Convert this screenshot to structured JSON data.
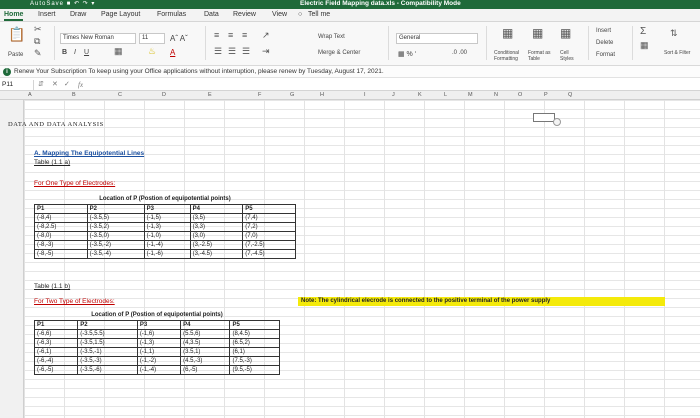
{
  "titlebar": {
    "quick_access": "AutoSave   ■ ↶ ↷ ▾",
    "title": "Electric Field Mapping data.xls  -  Compatibility Mode"
  },
  "tabs": [
    "Home",
    "Insert",
    "Draw",
    "Page Layout",
    "Formulas",
    "Data",
    "Review",
    "View"
  ],
  "tell_me": "Tell me",
  "ribbon": {
    "paste_label": "Paste",
    "font_name": "Times New Roman",
    "font_size": "11",
    "wrap_text": "Wrap Text",
    "merge_center": "Merge & Center",
    "number_format": "General",
    "conditional_formatting": "Conditional Formatting",
    "format_as_table": "Format as Table",
    "cell_styles": "Cell Styles",
    "insert": "Insert",
    "delete": "Delete",
    "format": "Format",
    "sort_filter": "Sort & Filter"
  },
  "notice": {
    "message": "Renew Your Subscription  To keep using your Office applications without interruption, please renew by Tuesday, August 17, 2021."
  },
  "formula_bar": {
    "cell_ref": "P11",
    "fx": "fx"
  },
  "columns": [
    "A",
    "B",
    "C",
    "D",
    "E",
    "F",
    "G",
    "H",
    "I",
    "J",
    "K",
    "L",
    "M",
    "N",
    "O",
    "P",
    "Q"
  ],
  "sheet": {
    "main_heading": "DATA AND DATA ANALYSIS",
    "section_title": "A. Mapping  The Equipotential Lines",
    "table1_label": "Table (1.1 a)",
    "table1_subtitle": "For One Type of Electrodes:",
    "table1_location_header": "Location of P (Postion of equipotential points)",
    "table1_headers": [
      "P1",
      "P2",
      "P3",
      "P4",
      "P5"
    ],
    "table1_rows": [
      [
        "(-8,4)",
        "(-3.5,5)",
        "(-1,5)",
        "(3,5)",
        "(7,4)"
      ],
      [
        "(-8,2.5)",
        "(-3.5,2)",
        "(-1,3)",
        "(3,3)",
        "(7,2)"
      ],
      [
        "(-8,0)",
        "(-3.5,0)",
        "(-1,0)",
        "(3,0)",
        "(7,0)"
      ],
      [
        "(-8,-3)",
        "(-3.5,-2)",
        "(-1,-4)",
        "(3,-2.5)",
        "(7,-2.5)"
      ],
      [
        "(-8,-5)",
        "(-3.5,-4)",
        "(-1,-6)",
        "(3,-4.5)",
        "(7,-4.5)"
      ]
    ],
    "table2_label": "Table (1.1 b)",
    "table2_subtitle": "For Two Type of Electrodes:",
    "table2_location_header": "Location of P (Postion of equipotential points)",
    "table2_headers": [
      "P1",
      "P2",
      "P3",
      "P4",
      "P5"
    ],
    "table2_rows": [
      [
        "(-6,6)",
        "(-3.5,5.5)",
        "(-1,6)",
        "(5.5,6)",
        "(8,4.5)"
      ],
      [
        "(-6,3)",
        "(-3.5,1.5)",
        "(-1,3)",
        "(4,3.5)",
        "(6.5,2)"
      ],
      [
        "(-6,1)",
        "(-3.5,-1)",
        "(-1,1)",
        "(3.5,1)",
        "(6,1)"
      ],
      [
        "(-6,-4)",
        "(-3.5,-3)",
        "(-1,-2)",
        "(4.5,-3)",
        "(7.5,-3)"
      ],
      [
        "(-6,-5)",
        "(-3.5,-6)",
        "(-1,-4)",
        "(6,-5)",
        "(9.5,-5)"
      ]
    ],
    "note": "Note: The cylindrical elecrode is connected to the positive  terminal of the power supply"
  }
}
